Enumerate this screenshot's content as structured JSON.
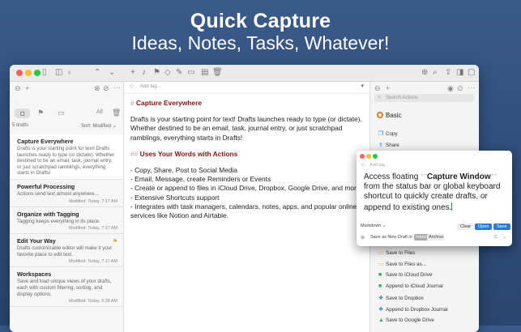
{
  "hero": {
    "title": "Quick Capture",
    "subtitle": "Ideas, Notes, Tasks, Whatever!"
  },
  "colors": {
    "accent": "#e8782b",
    "heading": "#8a1010",
    "link_blue": "#2a7ad6",
    "flag": "#f0a020"
  },
  "left": {
    "all_label": "All",
    "count": "5 drafts",
    "sort": "Sort: Modified",
    "drafts": [
      {
        "title": "Capture Everywhere",
        "desc": "Drafts is your starting point for text! Drafts launches ready to type (or dictate). Whether destined to be an email, task, journal entry, or just scratchpad ramblings, everything starts in Drafts!",
        "meta": ""
      },
      {
        "title": "Powerful Processing",
        "desc": "Actions send text almost anywhere...",
        "meta": "Modified: Today, 7:17 AM"
      },
      {
        "title": "Organize with Tagging",
        "desc": "Tagging keeps everything in its place.",
        "meta": "Modified: Today, 7:17 AM"
      },
      {
        "title": "Edit Your Way",
        "desc": "Drafts customizable editor will make it your favorite place to edit text.",
        "meta": "Modified: Today, 7:17 AM",
        "flagged": true
      },
      {
        "title": "Workspaces",
        "desc": "Save and load unique views of your drafts, each with custom filtering, sorting, and display options.",
        "meta": "Modified: Today, 6:38 AM"
      }
    ]
  },
  "editor": {
    "tag_placeholder": "Add tag...",
    "heading1": "Capture Everywhere",
    "para1": "Drafts is your starting point for text! Drafts launches ready to type (or dictate). Whether destined to be an email, task, journal entry, or just scratchpad ramblings, everything starts in Drafts!",
    "heading2": "Uses Your Words with Actions",
    "bullets": [
      "- Copy, Share, Post to Social Media",
      "- Email, Message, create Reminders or Events",
      "- Create or append to files in iCloud Drive, Dropbox, Google Drive, and more",
      "- Extensive Shortcuts support",
      "- Integrates with task managers, calendars, notes, apps, and popular online services like Notion and Airtable."
    ]
  },
  "right": {
    "search_placeholder": "Search Actions",
    "group": "Basic",
    "top_actions": [
      {
        "icon": "copy-icon",
        "label": "Copy"
      },
      {
        "icon": "share-icon",
        "label": "Share"
      }
    ],
    "bottom_actions": [
      {
        "icon": "file-icon",
        "label": "Save to Files"
      },
      {
        "icon": "file-icon",
        "label": "Save to Files as..."
      },
      {
        "icon": "icloud-icon",
        "label": "Save to iCloud Drive"
      },
      {
        "icon": "icloud-icon",
        "label": "Append to iCloud Journal"
      },
      {
        "icon": "dropbox-icon",
        "label": "Save to Dropbox"
      },
      {
        "icon": "dropbox-icon",
        "label": "Append to Dropbox Journal"
      },
      {
        "icon": "google-drive-icon",
        "label": "Save to Google Drive"
      }
    ]
  },
  "panel": {
    "tag_placeholder": "Add tag...",
    "text_before": "Access floating ",
    "marker_open": "**",
    "bold": "Capture Window",
    "marker_close": "**",
    "text_after": " from the status bar or global keyboard shortcut to quickly create drafts, or append to existing ones.",
    "syntax": "Markdown",
    "save_label": "Save as New Draft in",
    "inbox_label": "Inbox",
    "archive_label": "Archive",
    "clear_label": "Clear",
    "open_label": "Open",
    "save_btn": "Save"
  }
}
